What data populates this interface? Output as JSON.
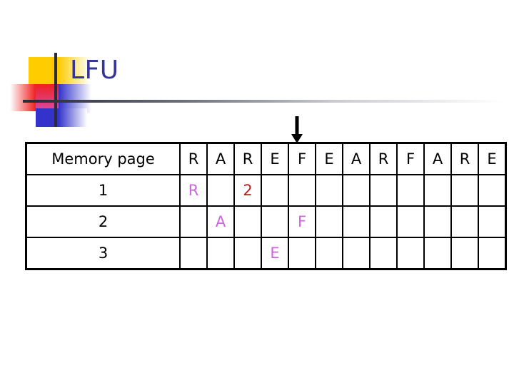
{
  "slide": {
    "title": "LFU",
    "title_color": "#333399",
    "arrow_icon": "down-arrow-icon",
    "arrow_target_column_index": 4
  },
  "table": {
    "header_label": "Memory page",
    "reference_string": [
      "R",
      "A",
      "R",
      "E",
      "F",
      "E",
      "A",
      "R",
      "F",
      "A",
      "R",
      "E"
    ],
    "rows": [
      {
        "label": "1",
        "cells": [
          {
            "text": "R",
            "color": "#CC66DD"
          },
          {
            "text": "",
            "color": ""
          },
          {
            "text": "2",
            "color": "#B81F1F"
          },
          {
            "text": "",
            "color": ""
          },
          {
            "text": "",
            "color": ""
          },
          {
            "text": "",
            "color": ""
          },
          {
            "text": "",
            "color": ""
          },
          {
            "text": "",
            "color": ""
          },
          {
            "text": "",
            "color": ""
          },
          {
            "text": "",
            "color": ""
          },
          {
            "text": "",
            "color": ""
          },
          {
            "text": "",
            "color": ""
          }
        ]
      },
      {
        "label": "2",
        "cells": [
          {
            "text": "",
            "color": ""
          },
          {
            "text": "A",
            "color": "#CC66DD"
          },
          {
            "text": "",
            "color": ""
          },
          {
            "text": "",
            "color": ""
          },
          {
            "text": "F",
            "color": "#CC66DD"
          },
          {
            "text": "",
            "color": ""
          },
          {
            "text": "",
            "color": ""
          },
          {
            "text": "",
            "color": ""
          },
          {
            "text": "",
            "color": ""
          },
          {
            "text": "",
            "color": ""
          },
          {
            "text": "",
            "color": ""
          },
          {
            "text": "",
            "color": ""
          }
        ]
      },
      {
        "label": "3",
        "cells": [
          {
            "text": "",
            "color": ""
          },
          {
            "text": "",
            "color": ""
          },
          {
            "text": "",
            "color": ""
          },
          {
            "text": "E",
            "color": "#CC66DD"
          },
          {
            "text": "",
            "color": ""
          },
          {
            "text": "",
            "color": ""
          },
          {
            "text": "",
            "color": ""
          },
          {
            "text": "",
            "color": ""
          },
          {
            "text": "",
            "color": ""
          },
          {
            "text": "",
            "color": ""
          },
          {
            "text": "",
            "color": ""
          },
          {
            "text": "",
            "color": ""
          }
        ]
      }
    ]
  },
  "decoration": {
    "colors": {
      "yellow": "#FFCC00",
      "red": "#F02020",
      "blue": "#3333CC",
      "rule_dark": "#2B2B3C"
    }
  }
}
